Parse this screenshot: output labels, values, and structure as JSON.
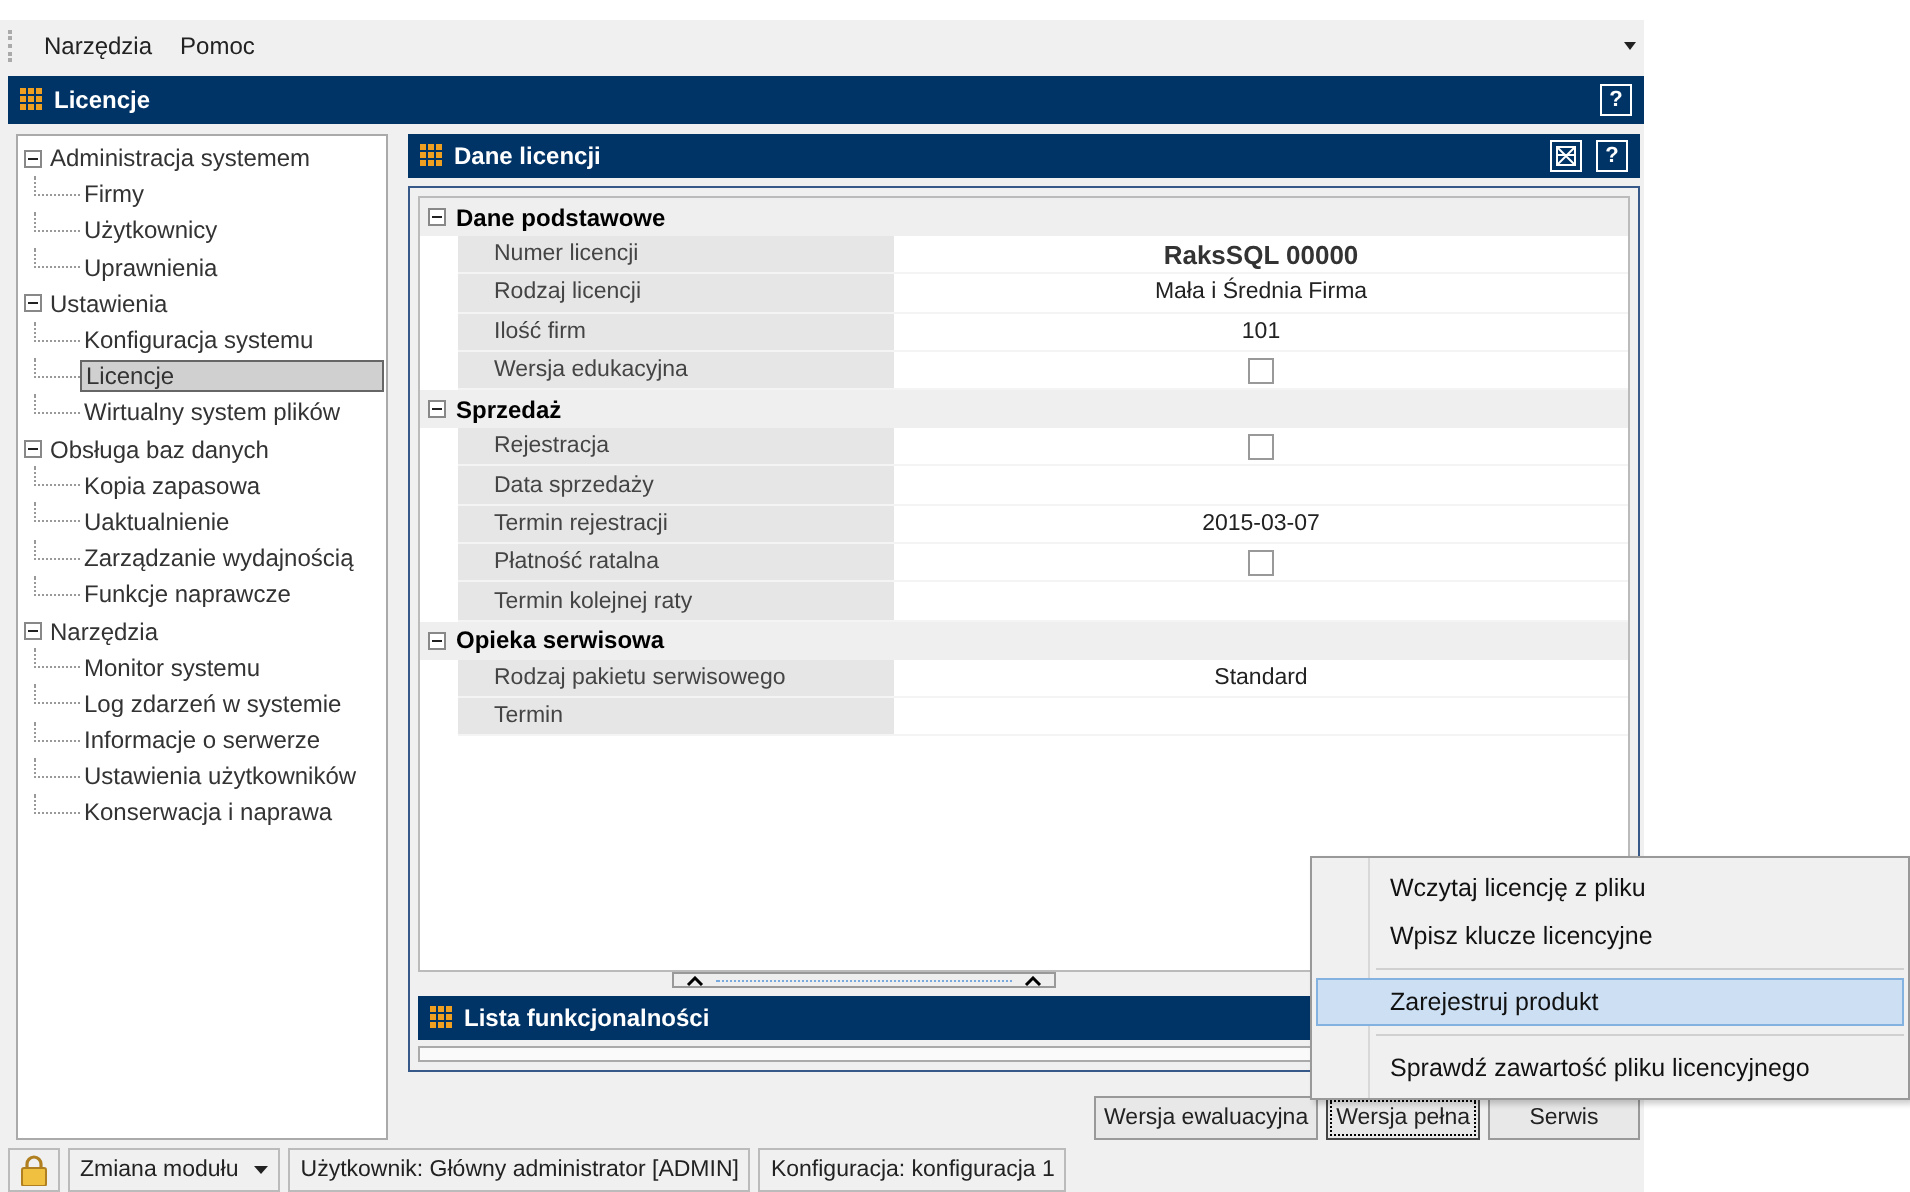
{
  "menu_bar": {
    "items": [
      "Narzędzia",
      "Pomoc"
    ]
  },
  "window": {
    "title": "Licencje",
    "help": "?"
  },
  "tree": [
    {
      "label": "Administracja systemem",
      "expanded": true,
      "selected": false,
      "children": [
        {
          "label": "Firmy",
          "selected": false
        },
        {
          "label": "Użytkownicy",
          "selected": false
        },
        {
          "label": "Uprawnienia",
          "selected": false
        }
      ]
    },
    {
      "label": "Ustawienia",
      "expanded": true,
      "selected": false,
      "children": [
        {
          "label": "Konfiguracja systemu",
          "selected": false
        },
        {
          "label": "Licencje",
          "selected": true
        },
        {
          "label": "Wirtualny system plików",
          "selected": false
        }
      ]
    },
    {
      "label": "Obsługa baz danych",
      "expanded": true,
      "selected": false,
      "children": [
        {
          "label": "Kopia zapasowa",
          "selected": false
        },
        {
          "label": "Uaktualnienie",
          "selected": false
        },
        {
          "label": "Zarządzanie wydajnością",
          "selected": false
        },
        {
          "label": "Funkcje naprawcze",
          "selected": false
        }
      ]
    },
    {
      "label": "Narzędzia",
      "expanded": true,
      "selected": false,
      "children": [
        {
          "label": "Monitor systemu",
          "selected": false
        },
        {
          "label": "Log zdarzeń w systemie",
          "selected": false
        },
        {
          "label": "Informacje o serwerze",
          "selected": false
        },
        {
          "label": "Ustawienia użytkowników",
          "selected": false
        },
        {
          "label": "Konserwacja i naprawa",
          "selected": false
        }
      ]
    }
  ],
  "panel": {
    "title": "Dane licencji",
    "help": "?",
    "sections": [
      {
        "title": "Dane podstawowe",
        "expanded": true,
        "rows": [
          {
            "label": "Numer licencji",
            "kind": "bold",
            "value": "RaksSQL 00000"
          },
          {
            "label": "Rodzaj licencji",
            "kind": "text",
            "value": "Mała i Średnia Firma"
          },
          {
            "label": "Ilość firm",
            "kind": "text",
            "value": "101"
          },
          {
            "label": "Wersja edukacyjna",
            "kind": "checkbox",
            "checked": false
          }
        ]
      },
      {
        "title": "Sprzedaż",
        "expanded": true,
        "rows": [
          {
            "label": "Rejestracja",
            "kind": "checkbox",
            "checked": false
          },
          {
            "label": "Data sprzedaży",
            "kind": "text"
          },
          {
            "label": "Termin rejestracji",
            "kind": "text",
            "value": "2015-03-07"
          },
          {
            "label": "Płatność ratalna",
            "kind": "checkbox",
            "checked": false
          },
          {
            "label": "Termin kolejnej raty",
            "kind": "text"
          }
        ]
      },
      {
        "title": "Opieka serwisowa",
        "expanded": true,
        "rows": [
          {
            "label": "Rodzaj pakietu serwisowego",
            "kind": "text",
            "value": "Standard"
          },
          {
            "label": "Termin",
            "kind": "text"
          }
        ]
      }
    ]
  },
  "features_panel": {
    "title": "Lista funkcjonalności"
  },
  "buttons": [
    {
      "label": "Wersja ewaluacyjna",
      "focused": false
    },
    {
      "label": "Wersja pełna",
      "focused": true
    },
    {
      "label": "Serwis",
      "focused": false
    }
  ],
  "context_menu": {
    "groups": [
      [
        {
          "label": "Wczytaj licencję z pliku",
          "selected": false
        },
        {
          "label": "Wpisz klucze licencyjne",
          "selected": false
        }
      ],
      [
        {
          "label": "Zarejestruj produkt",
          "selected": true
        }
      ],
      [
        {
          "label": "Sprawdź zawartość pliku licencyjnego",
          "selected": false
        }
      ]
    ]
  },
  "status_bar": {
    "module": "Zmiana modułu",
    "user": "Użytkownik: Główny administrator [ADMIN]",
    "config": "Konfiguracja: konfiguracja 1"
  }
}
